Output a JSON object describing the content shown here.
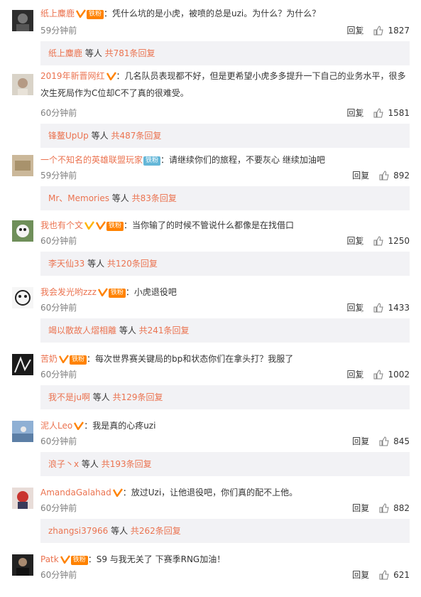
{
  "comments": [
    {
      "user": "纸上麋鹿",
      "fan_label": "铁粉",
      "text": "：凭什么坑的是小虎，被喷的总是uzi。为什么？为什么？",
      "time": "59分钟前",
      "reply": "回复",
      "likes": "1827",
      "replies": {
        "who": "纸上麋鹿",
        "etc": " 等人 ",
        "count": "共781条回复"
      }
    },
    {
      "user": "2019年新晋网红",
      "fan_label": "",
      "text": "：几名队员表现都不好，但是更希望小虎多多提升一下自己的业务水平，很多次生死局作为C位却C不了真的很难受。",
      "time": "60分钟前",
      "reply": "回复",
      "likes": "1581",
      "replies": {
        "who": "锋鳌UpUp",
        "etc": " 等人 ",
        "count": "共487条回复"
      }
    },
    {
      "user": "一个不知名的英雄联盟玩家",
      "fan_label": "铁粉",
      "text": "：请继续你们的旅程，不要灰心 继续加油吧",
      "time": "59分钟前",
      "reply": "回复",
      "likes": "892",
      "replies": {
        "who": "Mr、Memories",
        "etc": " 等人 ",
        "count": "共83条回复"
      }
    },
    {
      "user": "我也有个文",
      "fan_label": "铁粉",
      "text": "：当你输了的时候不管说什么都像是在找借口",
      "time": "60分钟前",
      "reply": "回复",
      "likes": "1250",
      "replies": {
        "who": "李天仙33",
        "etc": " 等人 ",
        "count": "共120条回复"
      }
    },
    {
      "user": "我会发光哟zzz",
      "fan_label": "铁粉",
      "text": "：小虎退役吧",
      "time": "60分钟前",
      "reply": "回复",
      "likes": "1433",
      "replies": {
        "who": "竭以散故人熠相離",
        "etc": " 等人 ",
        "count": "共241条回复"
      }
    },
    {
      "user": "苦奶",
      "fan_label": "铁粉",
      "text": "：每次世界赛关键局的bp和状态你们在拿头打？我服了",
      "time": "60分钟前",
      "reply": "回复",
      "likes": "1002",
      "replies": {
        "who": "我不是ju啊",
        "etc": " 等人 ",
        "count": "共129条回复"
      }
    },
    {
      "user": "泥人Leo",
      "fan_label": "",
      "text": "：我是真的心疼uzi",
      "time": "60分钟前",
      "reply": "回复",
      "likes": "845",
      "replies": {
        "who": "浪子丶x",
        "etc": " 等人 ",
        "count": "共193条回复"
      }
    },
    {
      "user": "AmandaGalahad",
      "fan_label": "",
      "text": "：放过Uzi，让他退役吧，你们真的配不上他。",
      "time": "60分钟前",
      "reply": "回复",
      "likes": "882",
      "replies": {
        "who": "zhangsi37966",
        "etc": " 等人 ",
        "count": "共262条回复"
      }
    },
    {
      "user": "Patk",
      "fan_label": "铁粉",
      "text": "：S9 与我无关了 下赛季RNG加油！",
      "time": "60分钟前",
      "reply": "回复",
      "likes": "621",
      "replies": null
    }
  ],
  "colors": {
    "username": "#eb7350",
    "meta": "#808080",
    "reply_bg": "#f2f2f5"
  }
}
